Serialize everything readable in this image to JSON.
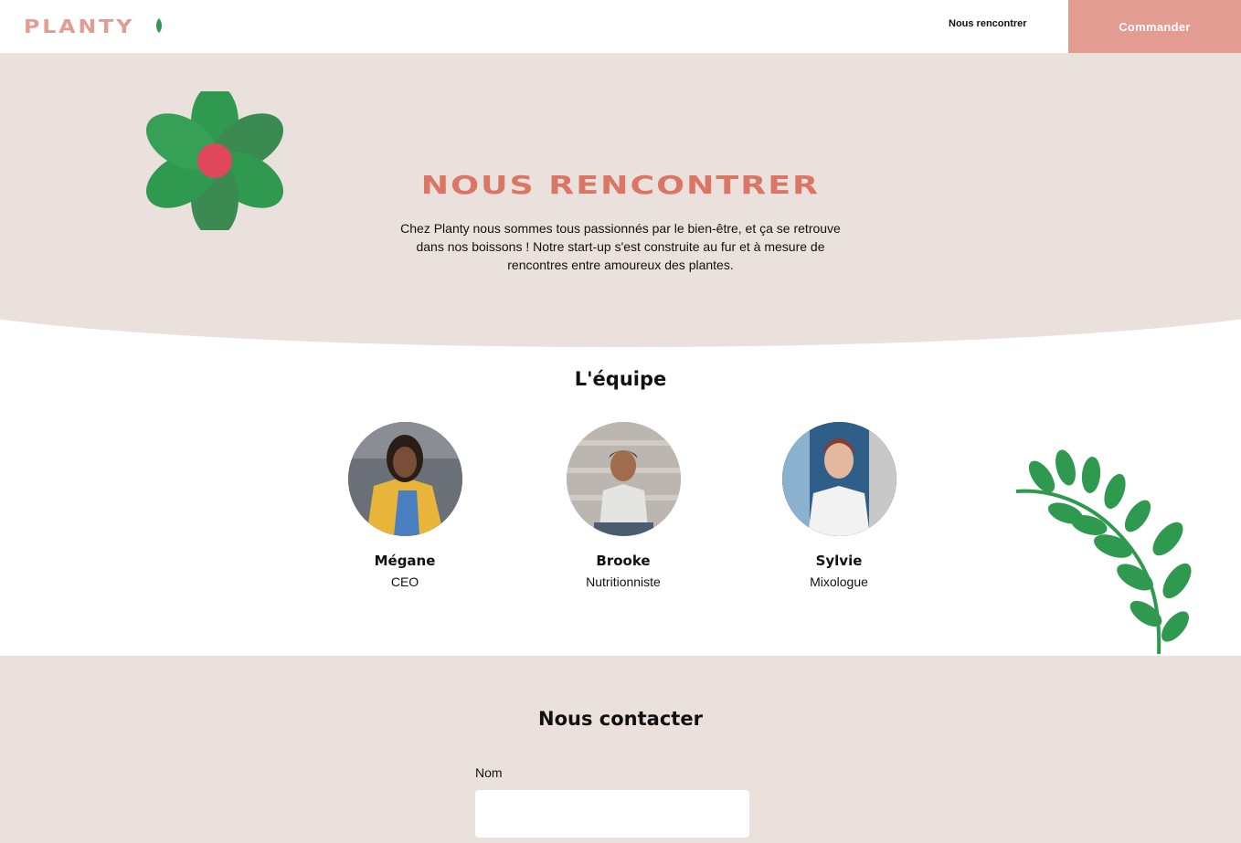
{
  "header": {
    "logo_text": "PLANTY",
    "nav_link": "Nous rencontrer",
    "order_button": "Commander"
  },
  "hero": {
    "title": "NOUS RENCONTRER",
    "text": "Chez Planty nous sommes tous passionnés par le bien-être, et ça se retrouve dans nos boissons ! Notre start-up s'est construite au fur et à mesure de rencontres entre amoureux des plantes."
  },
  "team": {
    "title": "L'équipe",
    "members": [
      {
        "name": "Mégane",
        "role": "CEO"
      },
      {
        "name": "Brooke",
        "role": "Nutritionniste"
      },
      {
        "name": "Sylvie",
        "role": "Mixologue"
      }
    ]
  },
  "contact": {
    "title": "Nous contacter",
    "name_label": "Nom",
    "name_value": ""
  },
  "colors": {
    "brand_pink": "#e29c92",
    "title_coral": "#db7666",
    "hero_bg": "#ebe1dc",
    "leaf_green": "#2f9950"
  }
}
